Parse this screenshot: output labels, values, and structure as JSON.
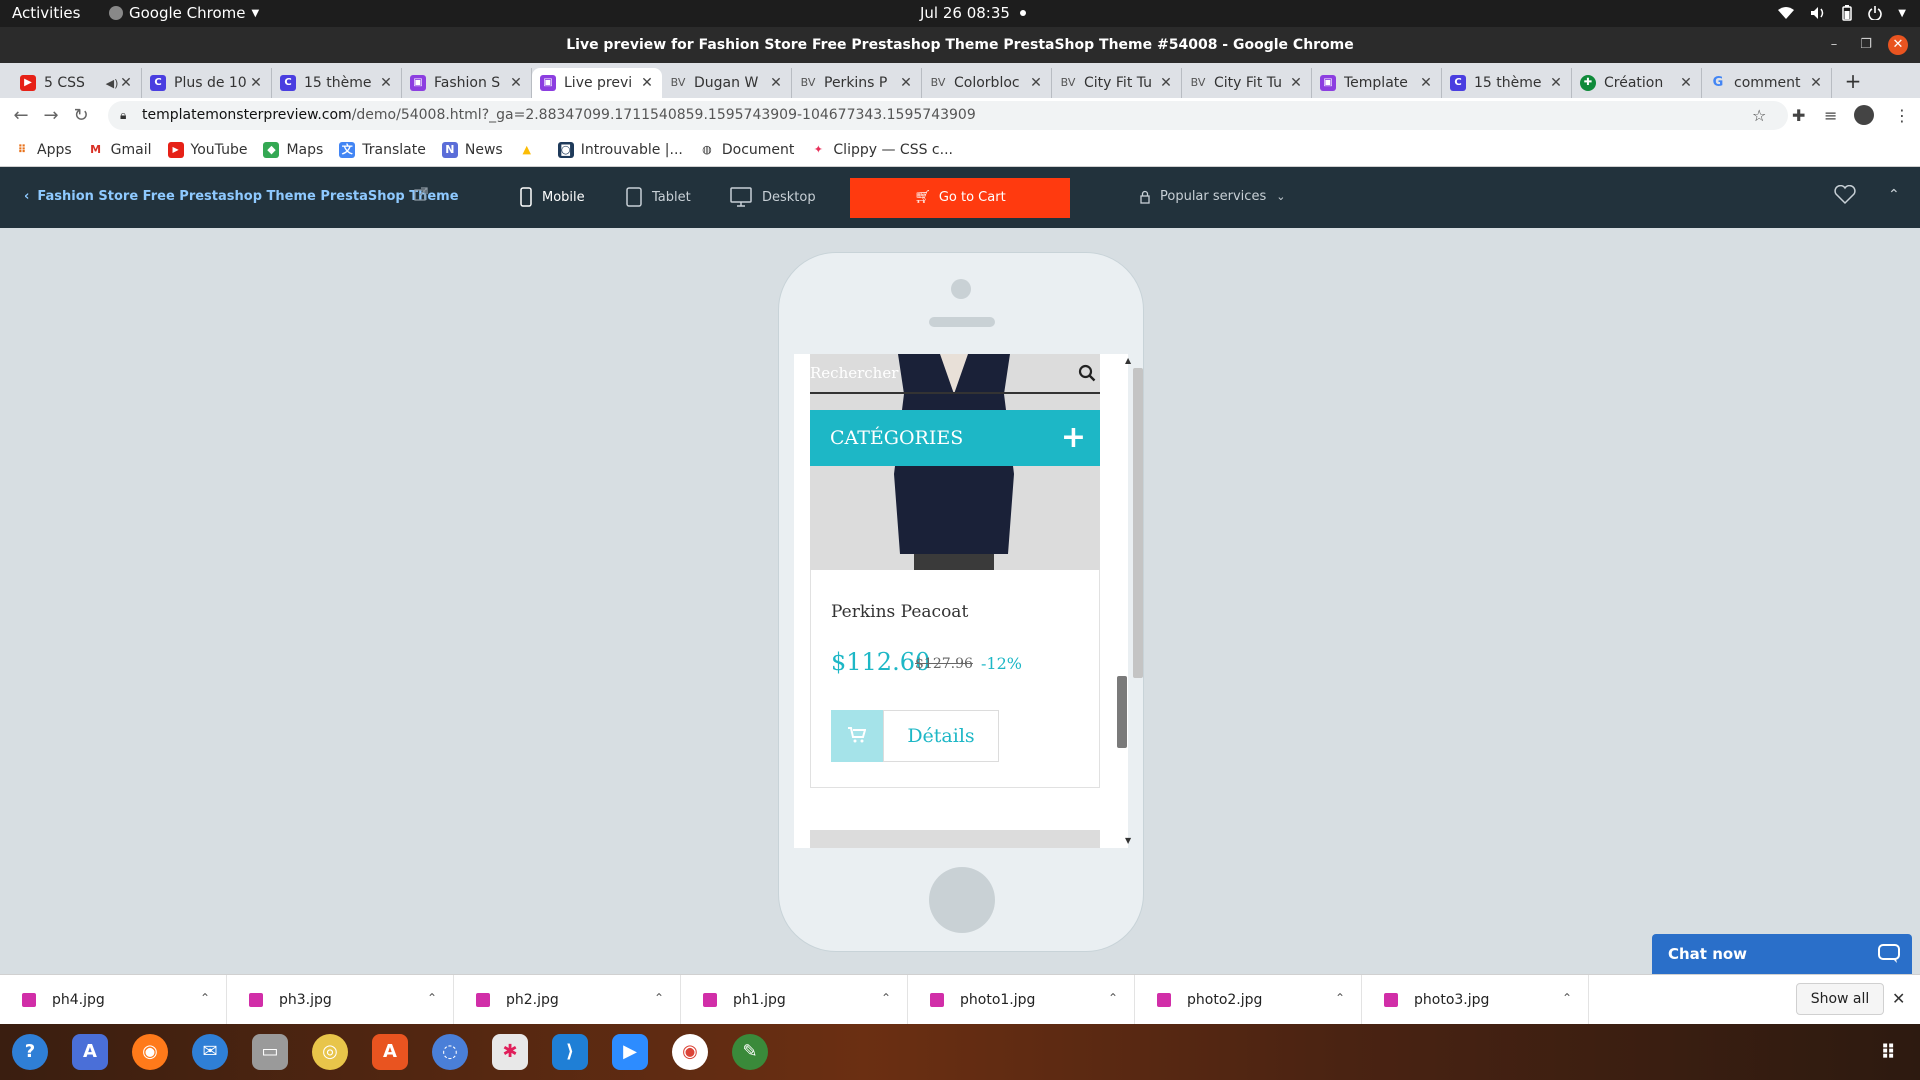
{
  "system": {
    "activities": "Activities",
    "app_menu": "Google Chrome",
    "clock": "Jul 26  08:35"
  },
  "window": {
    "title": "Live preview for Fashion Store Free Prestashop Theme PrestaShop Theme #54008 - Google Chrome"
  },
  "tabs": [
    {
      "label": "5 CSS",
      "color": "#e62117",
      "active": false
    },
    {
      "label": "Plus de 10",
      "color": "#4a3ee0",
      "active": false
    },
    {
      "label": "15 thème",
      "color": "#4a3ee0",
      "active": false
    },
    {
      "label": "Fashion S",
      "color": "#8c3ee0",
      "active": false
    },
    {
      "label": "Live previ",
      "color": "#8c3ee0",
      "active": true
    },
    {
      "label": "Dugan W",
      "color": "#7a7a7a",
      "active": false
    },
    {
      "label": "Perkins P",
      "color": "#7a7a7a",
      "active": false
    },
    {
      "label": "Colorbloc",
      "color": "#7a7a7a",
      "active": false
    },
    {
      "label": "City Fit Tu",
      "color": "#7a7a7a",
      "active": false
    },
    {
      "label": "City Fit Tu",
      "color": "#7a7a7a",
      "active": false
    },
    {
      "label": "Template",
      "color": "#8c3ee0",
      "active": false
    },
    {
      "label": "15 thème",
      "color": "#4a3ee0",
      "active": false
    },
    {
      "label": "Création",
      "color": "#0f8a3a",
      "active": false
    },
    {
      "label": "comment",
      "color": "#4285f4",
      "active": false
    }
  ],
  "address": {
    "host": "templatemonsterpreview.com",
    "path": "/demo/54008.html?_ga=2.88347099.1711540859.1595743909-104677343.1595743909"
  },
  "bookmarks": [
    {
      "label": "Apps",
      "color": "#e8711a"
    },
    {
      "label": "Gmail",
      "color": "#d93025"
    },
    {
      "label": "YouTube",
      "color": "#e62117"
    },
    {
      "label": "Maps",
      "color": "#34a853"
    },
    {
      "label": "Translate",
      "color": "#4285f4"
    },
    {
      "label": "News",
      "color": "#5b6dd8"
    },
    {
      "label": "",
      "color": "#fbbc05"
    },
    {
      "label": "Introuvable |...",
      "color": "#1f3a5a"
    },
    {
      "label": "Document",
      "color": "#333333"
    },
    {
      "label": "Clippy — CSS c...",
      "color": "#e8315b"
    }
  ],
  "tm": {
    "back_label": "Fashion Store Free Prestashop Theme PrestaShop Theme",
    "mobile": "Mobile",
    "tablet": "Tablet",
    "desktop": "Desktop",
    "cart": "Go to Cart",
    "popular": "Popular services",
    "accent": "#ff3a0f"
  },
  "preview": {
    "search_placeholder": "Rechercher",
    "categories": "CATÉGORIES",
    "product_name": "Perkins Peacoat",
    "price": "$112.60",
    "old_price": "$127.96",
    "discount": "-12%",
    "details": "Détails",
    "accent": "#1db7c6"
  },
  "chat": {
    "label": "Chat now"
  },
  "downloads": {
    "items": [
      "ph4.jpg",
      "ph3.jpg",
      "ph2.jpg",
      "ph1.jpg",
      "photo1.jpg",
      "photo2.jpg",
      "photo3.jpg"
    ],
    "show_all": "Show all"
  }
}
